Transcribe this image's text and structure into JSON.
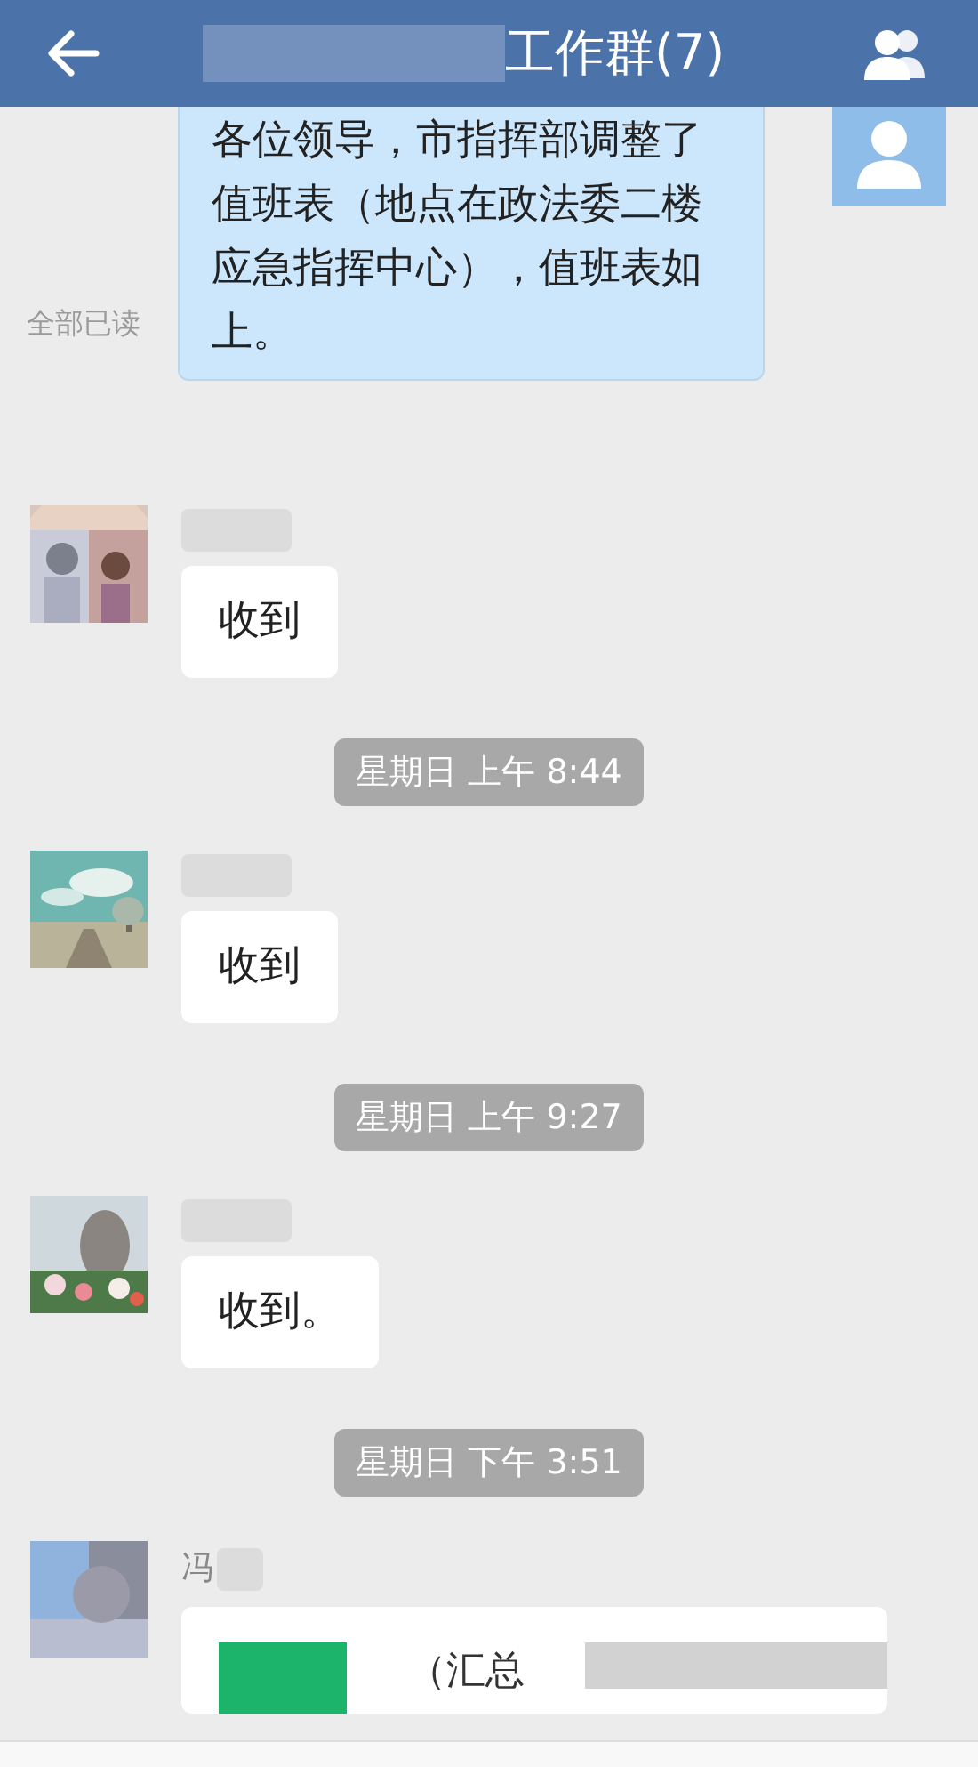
{
  "header": {
    "title": "工作群(7)"
  },
  "messages": [
    {
      "kind": "outgoing",
      "text": "各位领导，市指挥部调整了值班表（地点在政法委二楼应急指挥中心），值班表如上。",
      "read_status": "全部已读"
    },
    {
      "kind": "incoming",
      "text": "收到"
    },
    {
      "kind": "time",
      "text": "星期日 上午 8:44"
    },
    {
      "kind": "incoming",
      "text": "收到"
    },
    {
      "kind": "time",
      "text": "星期日 上午 9:27"
    },
    {
      "kind": "incoming",
      "text": "收到。"
    },
    {
      "kind": "time",
      "text": "星期日 下午 3:51"
    },
    {
      "kind": "file",
      "name": "冯",
      "text": "（汇总"
    }
  ]
}
